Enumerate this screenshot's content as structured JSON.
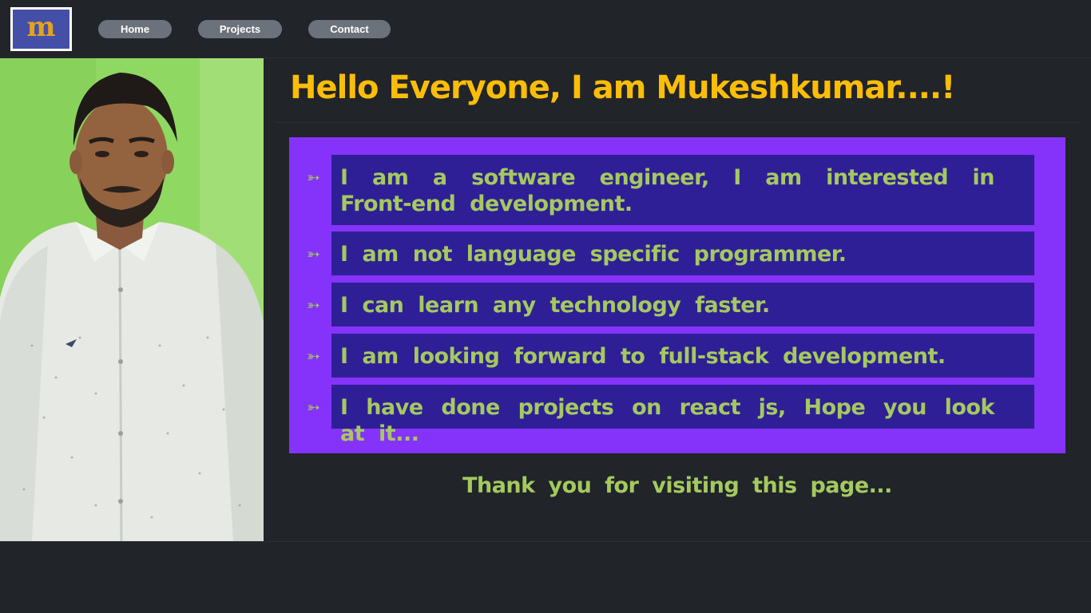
{
  "nav": {
    "logo_letter": "m",
    "links": [
      "Home",
      "Projects",
      "Contact"
    ]
  },
  "profile": {
    "photo_alt": "profile photo"
  },
  "main": {
    "heading": "Hello Everyone, I am Mukeshkumar....!",
    "bullet_icon": "➳",
    "items": [
      "I am a software engineer, I am interested in Front-end development.",
      "I am not language specific programmer.",
      "I can learn any technology faster.",
      "I am looking forward to full-stack development.",
      "I have done projects on react js, Hope you look at it..."
    ],
    "thanks": "Thank you for visiting this page..."
  },
  "colors": {
    "background": "#212429",
    "heading": "#fbbd08",
    "panel": "#8533fb",
    "item_bg": "#2f1f96",
    "text_green": "#a4c95f",
    "nav_button": "#6c727b"
  }
}
